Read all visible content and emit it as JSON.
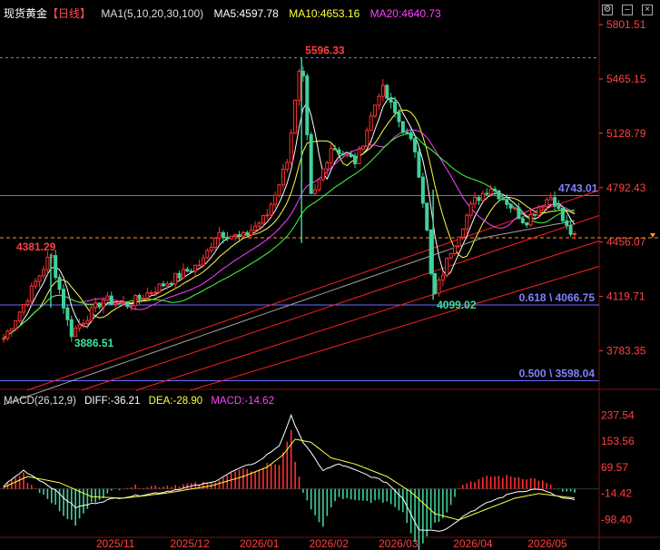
{
  "header": {
    "symbol": "现货黄金",
    "period": "【日线】",
    "ma_label": "MA1(5,10,20,30,100)",
    "ma5": "MA5:4597.78",
    "ma10": "MA10:4653.16",
    "ma20": "MA20:4640.73"
  },
  "macd_header": {
    "label": "MACD(26,12,9)",
    "diff": "DIFF:-36.21",
    "dea": "DEA:-28.90",
    "macd": "MACD:-14.62"
  },
  "chart_data": [
    {
      "type": "candlestick",
      "title": "现货黄金【日线】",
      "y_ticks": [
        5801.51,
        5465.15,
        5128.79,
        4792.43,
        4456.07,
        4119.71,
        3783.35
      ],
      "ylim": [
        3550,
        5830
      ],
      "x_ticks": [
        "2025/11",
        "2025/12",
        "2026/01",
        "2026/02",
        "2026/03",
        "2026/04",
        "2026/05"
      ],
      "annotations": [
        {
          "text": "5596.33",
          "value": 5596.33,
          "kind": "high"
        },
        {
          "text": "4381.29",
          "value": 4381.29,
          "kind": "high"
        },
        {
          "text": "3886.51",
          "value": 3886.51,
          "kind": "low"
        },
        {
          "text": "4099.02",
          "value": 4099.02,
          "kind": "low"
        },
        {
          "text": "4743.01",
          "value": 4743.01,
          "kind": "level"
        },
        {
          "text": "0.618 \\ 4066.75",
          "value": 4066.75,
          "kind": "fib"
        },
        {
          "text": "0.500 \\ 3598.04",
          "value": 3598.04,
          "kind": "fib"
        }
      ],
      "horizontal_levels": [
        5596.33,
        4743.01,
        4066.75,
        3598.04
      ],
      "last_price": 4482,
      "colors": {
        "up": "#ff3030",
        "down": "#3fd29a",
        "ma5": "#ffffff",
        "ma10": "#ffff40",
        "ma20": "#ff40ff",
        "ma30": "#40ff40",
        "ma100": "#a0a0a0",
        "level": "#7777ff",
        "channel": "#ff2020"
      },
      "key_points": [
        [
          "2025-10-01",
          3860
        ],
        [
          "2025-10-08",
          4040
        ],
        [
          "2025-10-20",
          4381.29
        ],
        [
          "2025-10-28",
          3886.51
        ],
        [
          "2025-11-10",
          4100
        ],
        [
          "2025-11-20",
          4070
        ],
        [
          "2025-12-05",
          4200
        ],
        [
          "2025-12-20",
          4330
        ],
        [
          "2025-12-26",
          4520
        ],
        [
          "2026-01-05",
          4480
        ],
        [
          "2026-01-15",
          4620
        ],
        [
          "2026-01-23",
          4950
        ],
        [
          "2026-01-29",
          5596.33
        ],
        [
          "2026-02-02",
          4700
        ],
        [
          "2026-02-10",
          5050
        ],
        [
          "2026-02-20",
          4950
        ],
        [
          "2026-03-02",
          5420
        ],
        [
          "2026-03-10",
          5180
        ],
        [
          "2026-03-16",
          5020
        ],
        [
          "2026-03-20",
          4600
        ],
        [
          "2026-03-23",
          4099.02
        ],
        [
          "2026-03-30",
          4400
        ],
        [
          "2026-04-08",
          4700
        ],
        [
          "2026-04-15",
          4800
        ],
        [
          "2026-04-22",
          4700
        ],
        [
          "2026-04-29",
          4580
        ],
        [
          "2026-05-06",
          4700
        ],
        [
          "2026-05-10",
          4743.01
        ],
        [
          "2026-05-15",
          4560
        ],
        [
          "2026-05-19",
          4482
        ]
      ]
    },
    {
      "type": "macd",
      "title": "MACD(26,12,9)",
      "y_ticks": [
        237.54,
        153.56,
        69.57,
        -14.42,
        -98.4
      ],
      "ylim": [
        -150,
        265
      ],
      "diff_key": [
        [
          0,
          10
        ],
        [
          5,
          60
        ],
        [
          12,
          5
        ],
        [
          18,
          -60
        ],
        [
          28,
          -30
        ],
        [
          40,
          -10
        ],
        [
          52,
          20
        ],
        [
          58,
          60
        ],
        [
          64,
          90
        ],
        [
          69,
          140
        ],
        [
          71,
          200
        ],
        [
          72,
          235
        ],
        [
          75,
          150
        ],
        [
          80,
          60
        ],
        [
          84,
          80
        ],
        [
          88,
          60
        ],
        [
          96,
          20
        ],
        [
          100,
          -30
        ],
        [
          104,
          -130
        ],
        [
          110,
          -135
        ],
        [
          116,
          -80
        ],
        [
          122,
          -40
        ],
        [
          128,
          -10
        ],
        [
          134,
          0
        ],
        [
          140,
          -30
        ],
        [
          143,
          -36.21
        ]
      ],
      "dea_key": [
        [
          0,
          5
        ],
        [
          6,
          40
        ],
        [
          14,
          20
        ],
        [
          22,
          -25
        ],
        [
          30,
          -30
        ],
        [
          40,
          -15
        ],
        [
          52,
          10
        ],
        [
          60,
          40
        ],
        [
          66,
          70
        ],
        [
          70,
          110
        ],
        [
          73,
          160
        ],
        [
          77,
          150
        ],
        [
          82,
          100
        ],
        [
          88,
          80
        ],
        [
          96,
          40
        ],
        [
          102,
          -10
        ],
        [
          108,
          -80
        ],
        [
          114,
          -100
        ],
        [
          120,
          -70
        ],
        [
          128,
          -30
        ],
        [
          134,
          -15
        ],
        [
          140,
          -25
        ],
        [
          143,
          -28.9
        ]
      ]
    }
  ]
}
